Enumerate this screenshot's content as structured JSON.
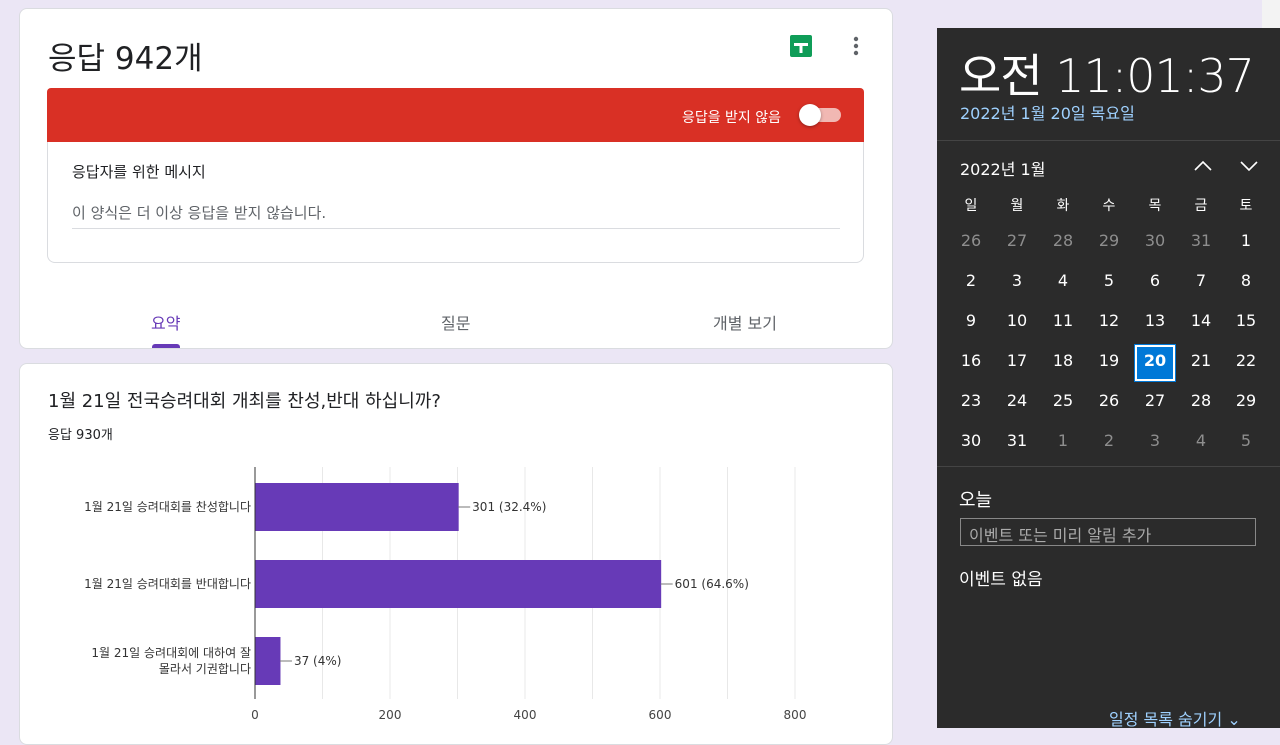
{
  "form": {
    "title": "응답 942개",
    "banner_text": "응답을 받지 않음",
    "accepting_responses": false,
    "message_label": "응답자를 위한 메시지",
    "message_value": "이 양식은 더 이상 응답을 받지 않습니다.",
    "tabs": [
      {
        "label": "요약",
        "active": true
      },
      {
        "label": "질문",
        "active": false
      },
      {
        "label": "개별 보기",
        "active": false
      }
    ],
    "colors": {
      "banner": "#d93025",
      "accent": "#673ab7",
      "bar": "#673ab7"
    }
  },
  "question": {
    "title": "1월 21일 전국승려대회 개최를 찬성,반대 하십니까?",
    "response_count": "응답 930개"
  },
  "chart_data": {
    "type": "bar",
    "orientation": "horizontal",
    "categories": [
      [
        "1월 21일 승려대회를 찬성합니다"
      ],
      [
        "1월 21일 승려대회를 반대합니다"
      ],
      [
        "1월 21일 승려대회에 대하여 잘",
        "몰라서 기권합니다"
      ]
    ],
    "values": [
      301,
      601,
      37
    ],
    "data_labels": [
      "301 (32.4%)",
      "601 (64.6%)",
      "37 (4%)"
    ],
    "xlim": [
      0,
      800
    ],
    "xticks": [
      0,
      200,
      400,
      600,
      800
    ],
    "grid": true,
    "color": "#673ab7"
  },
  "calendar": {
    "time": "오전 11:01:37",
    "date": "2022년 1월 20일 목요일",
    "month_label": "2022년 1월",
    "weekdays": [
      "일",
      "월",
      "화",
      "수",
      "목",
      "금",
      "토"
    ],
    "weeks": [
      [
        [
          26,
          true
        ],
        [
          27,
          true
        ],
        [
          28,
          true
        ],
        [
          29,
          true
        ],
        [
          30,
          true
        ],
        [
          31,
          true
        ],
        [
          1,
          false
        ]
      ],
      [
        [
          2,
          false
        ],
        [
          3,
          false
        ],
        [
          4,
          false
        ],
        [
          5,
          false
        ],
        [
          6,
          false
        ],
        [
          7,
          false
        ],
        [
          8,
          false
        ]
      ],
      [
        [
          9,
          false
        ],
        [
          10,
          false
        ],
        [
          11,
          false
        ],
        [
          12,
          false
        ],
        [
          13,
          false
        ],
        [
          14,
          false
        ],
        [
          15,
          false
        ]
      ],
      [
        [
          16,
          false
        ],
        [
          17,
          false
        ],
        [
          18,
          false
        ],
        [
          19,
          false
        ],
        [
          20,
          false
        ],
        [
          21,
          false
        ],
        [
          22,
          false
        ]
      ],
      [
        [
          23,
          false
        ],
        [
          24,
          false
        ],
        [
          25,
          false
        ],
        [
          26,
          false
        ],
        [
          27,
          false
        ],
        [
          28,
          false
        ],
        [
          29,
          false
        ]
      ],
      [
        [
          30,
          false
        ],
        [
          31,
          false
        ],
        [
          1,
          true
        ],
        [
          2,
          true
        ],
        [
          3,
          true
        ],
        [
          4,
          true
        ],
        [
          5,
          true
        ]
      ]
    ],
    "today": 20,
    "today_label": "오늘",
    "event_placeholder": "이벤트 또는 미리 알림 추가",
    "no_events": "이벤트 없음",
    "hide_list": "일정 목록 숨기기",
    "colors": {
      "bg": "#2b2b2b",
      "accent": "#0078d7",
      "link": "#9fd1ff"
    }
  }
}
